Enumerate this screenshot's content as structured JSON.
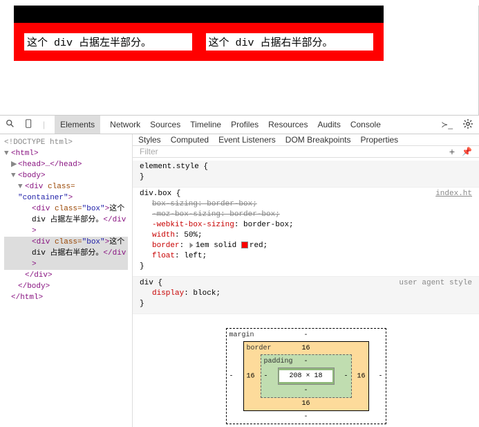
{
  "page": {
    "box1_text": "这个 div 占据左半部分。",
    "box2_text": "这个 div 占据右半部分。"
  },
  "toolbar": {
    "tabs": [
      "Elements",
      "Network",
      "Sources",
      "Timeline",
      "Profiles",
      "Resources",
      "Audits",
      "Console"
    ],
    "active": "Elements"
  },
  "dom": {
    "doctype": "<!DOCTYPE html>",
    "html_open": "<html>",
    "head": "<head>…</head>",
    "body_open": "<body>",
    "container_open_a": "<div ",
    "container_open_b": "class=",
    "container_open_c": "\"container\">",
    "box1_a": "<div class=\"box\">",
    "box1_text_a": "这个 div 占据左半部分。",
    "box1_close": "</div>",
    "box2_a": "<div class=\"box\">",
    "box2_text_a": "这个 div 占据右半部分。",
    "box2_close": "</div>",
    "container_close": "</div>",
    "body_close": "</body>",
    "html_close": "</html>"
  },
  "styles_tabs": [
    "Styles",
    "Computed",
    "Event Listeners",
    "DOM Breakpoints",
    "Properties"
  ],
  "filter_placeholder": "Filter",
  "rules": {
    "element_style": "element.style {",
    "brace_close": "}",
    "divbox_sel": "div.box {",
    "divbox_src": "index.ht",
    "p1": "box-sizing: border-box;",
    "p2": "-moz-box-sizing: border-box;",
    "p3_name": "-webkit-box-sizing",
    "p3_val": "border-box",
    "p4_name": "width",
    "p4_val": "50%",
    "p5_name": "border",
    "p5_val": "1em solid",
    "p5_color": "red",
    "p6_name": "float",
    "p6_val": "left",
    "div_sel": "div {",
    "div_src": "user agent style",
    "p7_name": "display",
    "p7_val": "block"
  },
  "box_model": {
    "margin_label": "margin",
    "border_label": "border",
    "padding_label": "padding",
    "content": "208 × 18",
    "margin_t": "-",
    "margin_b": "-",
    "margin_l": "-",
    "margin_r": "-",
    "border_t": "16",
    "border_b": "16",
    "border_l": "16",
    "border_r": "16",
    "padding_t": "-",
    "padding_b": "-",
    "padding_l": "-",
    "padding_r": "-"
  }
}
